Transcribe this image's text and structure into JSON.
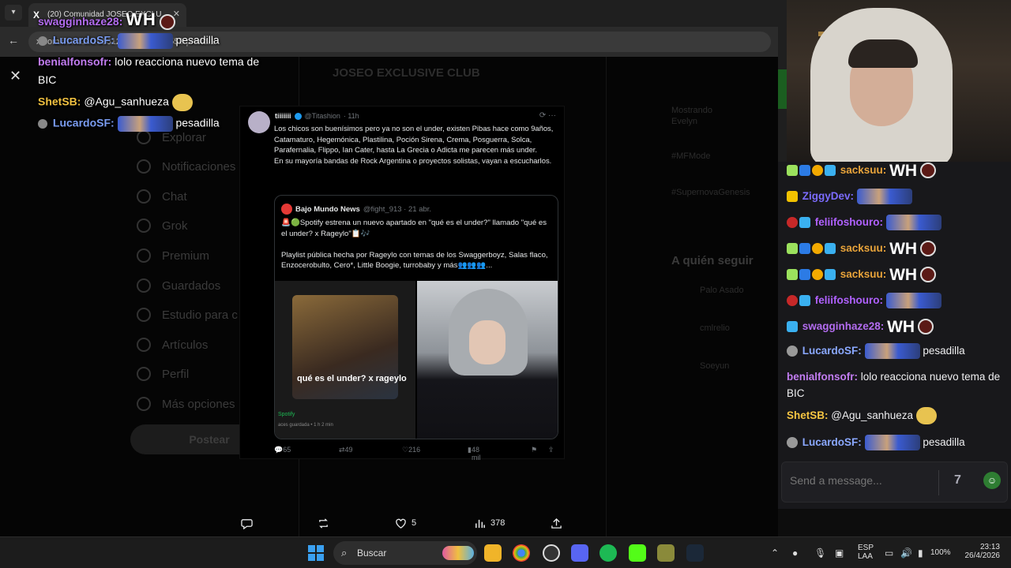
{
  "browser": {
    "tab_title": "(20) Comunidad JOSEO EXCLU",
    "favicon": "X",
    "url": "x.com/i/status/1916129476846723558/photo/1"
  },
  "x_background": {
    "feed_title": "JOSEO EXCLUSIVE CLUB",
    "sidebar": [
      "Explorar",
      "Notificaciones",
      "Chat",
      "Grok",
      "Premium",
      "Guardados",
      "Estudio para c",
      "Artículos",
      "Perfil",
      "Más opciones"
    ],
    "post_button": "Postear",
    "right_items": [
      "Mostrando",
      "Evelyn",
      "#MFMode",
      "#SupernovaGenesis"
    ],
    "who_to_follow": "A quién seguir",
    "suggestions": [
      "Palo Asado",
      "cmlrelio",
      "Soeyun"
    ]
  },
  "tweet": {
    "author": "tiiiiiii",
    "handle": "@Titashion",
    "time": "· 11h",
    "text": "Los chicos son buenísimos pero ya no son el under, existen Pibas hace como 9años, Catamaturo, Hegemónica, Plastilina, Poción Sirena, Crema, Posguerra, Solca, Parafernalia, Flippo, Ian Cater, hasta La Grecia o Adicta me parecen más under.\n En su mayoría bandas de Rock Argentina o proyectos solistas, vayan a escucharlos.",
    "quote": {
      "author": "Bajo Mundo News",
      "handle": "@fight_913 · 21 abr.",
      "text": "🚨🟢Spotify estrena un nuevo apartado en \"qué es el under?\" llamado \"qué es el under? x Rageylo\"📋🎶\n\nPlaylist pública hecha por Rageylo con temas de los Swaggerboyz, Salas flaco, Enzocerobulto, Cero*, Little Boogie, turrobaby y más👥👥👥...",
      "image_overlay_text": "qué es el under? x rageylo",
      "image_source": "Spotify",
      "image_sub": "aces guardada • 1 h 2 min"
    },
    "metrics": {
      "replies": "65",
      "reposts": "49",
      "likes": "216",
      "views": "48 mil"
    }
  },
  "photo_actions": {
    "replies": "",
    "reposts": "",
    "likes": "5",
    "views": "378"
  },
  "stream_overlay": [
    {
      "user": "swagginhaze28:",
      "text": "WH",
      "color": "#b36cf0"
    },
    {
      "user": "LucardoSF:",
      "text": "pesadilla",
      "color": "#7a9cf0"
    },
    {
      "user": "benialfonsofr:",
      "text": "lolo reacciona nuevo tema de",
      "color": "#c17cf0"
    },
    {
      "user": "",
      "text": "BIC",
      "color": "#ffffff"
    },
    {
      "user": "ShetSB:",
      "text": "@Agu_sanhueza",
      "color": "#f0c040"
    },
    {
      "user": "LucardoSF:",
      "text": "pesadilla",
      "color": "#7a9cf0"
    }
  ],
  "chat": {
    "messages": [
      {
        "user": "sacksuu:",
        "text": "WH",
        "color": "#e8a33a"
      },
      {
        "user": "ZiggyDev:",
        "text": "",
        "color": "#7c6cff"
      },
      {
        "user": "feliifoshouro:",
        "text": "",
        "color": "#b061ff"
      },
      {
        "user": "sacksuu:",
        "text": "WH",
        "color": "#e8a33a"
      },
      {
        "user": "sacksuu:",
        "text": "WH",
        "color": "#e8a33a"
      },
      {
        "user": "feliifoshouro:",
        "text": "",
        "color": "#b061ff"
      },
      {
        "user": "swagginhaze28:",
        "text": "WH",
        "color": "#b36cf0"
      },
      {
        "user": "LucardoSF:",
        "text": "pesadilla",
        "color": "#8aa8ff"
      },
      {
        "user": "benialfonsofr:",
        "text": "lolo reacciona nuevo tema de BIC",
        "color": "#c17cf0"
      },
      {
        "user": "ShetSB:",
        "text": "@Agu_sanhueza",
        "color": "#f5c542"
      },
      {
        "user": "LucardoSF:",
        "text": "pesadilla",
        "color": "#8aa8ff"
      }
    ],
    "input_placeholder": "Send a message..."
  },
  "taskbar": {
    "search_label": "Buscar",
    "lang": "ESP",
    "lang2": "LAA",
    "battery": "100%",
    "time": "23:13",
    "date": "26/4/2026"
  }
}
